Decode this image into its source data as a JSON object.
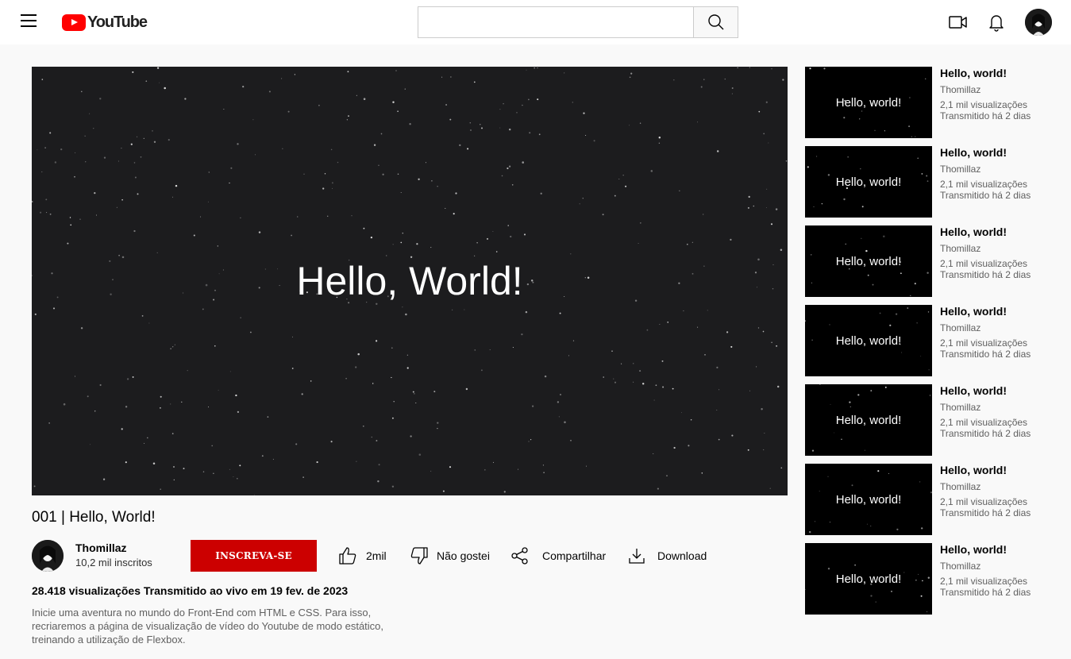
{
  "header": {
    "logo_text": "YouTube",
    "search_placeholder": ""
  },
  "player": {
    "overlay_text": "Hello, World!"
  },
  "video": {
    "title": "001 | Hello, World!",
    "stats": "28.418 visualizações Transmitido ao vivo em 19 fev. de 2023",
    "description": "Inicie uma aventura no mundo do Front-End com HTML e CSS. Para isso, recriaremos a página de visualização de vídeo do Youtube de modo estático, treinando a utilização de Flexbox."
  },
  "channel": {
    "name": "Thomillaz",
    "subscribers": "10,2 mil inscritos",
    "subscribe_label": "INSCREVA-SE"
  },
  "actions": {
    "like": "2mil",
    "dislike": "Não gostei",
    "share": "Compartilhar",
    "download": "Download"
  },
  "colors": {
    "brand_red": "#ff0000",
    "subscribe_red": "#cc0000",
    "player_bg": "#1c1c1e"
  },
  "recommendations": [
    {
      "thumb_text": "Hello, world!",
      "title": "Hello, world!",
      "channel": "Thomillaz",
      "views": "2,1 mil visualizações",
      "time": "Transmitido há 2 dias"
    },
    {
      "thumb_text": "Hello, world!",
      "title": "Hello, world!",
      "channel": "Thomillaz",
      "views": "2,1 mil visualizações",
      "time": "Transmitido há 2 dias"
    },
    {
      "thumb_text": "Hello, world!",
      "title": "Hello, world!",
      "channel": "Thomillaz",
      "views": "2,1 mil visualizações",
      "time": "Transmitido há 2 dias"
    },
    {
      "thumb_text": "Hello, world!",
      "title": "Hello, world!",
      "channel": "Thomillaz",
      "views": "2,1 mil visualizações",
      "time": "Transmitido há 2 dias"
    },
    {
      "thumb_text": "Hello, world!",
      "title": "Hello, world!",
      "channel": "Thomillaz",
      "views": "2,1 mil visualizações",
      "time": "Transmitido há 2 dias"
    },
    {
      "thumb_text": "Hello, world!",
      "title": "Hello, world!",
      "channel": "Thomillaz",
      "views": "2,1 mil visualizações",
      "time": "Transmitido há 2 dias"
    },
    {
      "thumb_text": "Hello, world!",
      "title": "Hello, world!",
      "channel": "Thomillaz",
      "views": "2,1 mil visualizações",
      "time": "Transmitido há 2 dias"
    }
  ]
}
